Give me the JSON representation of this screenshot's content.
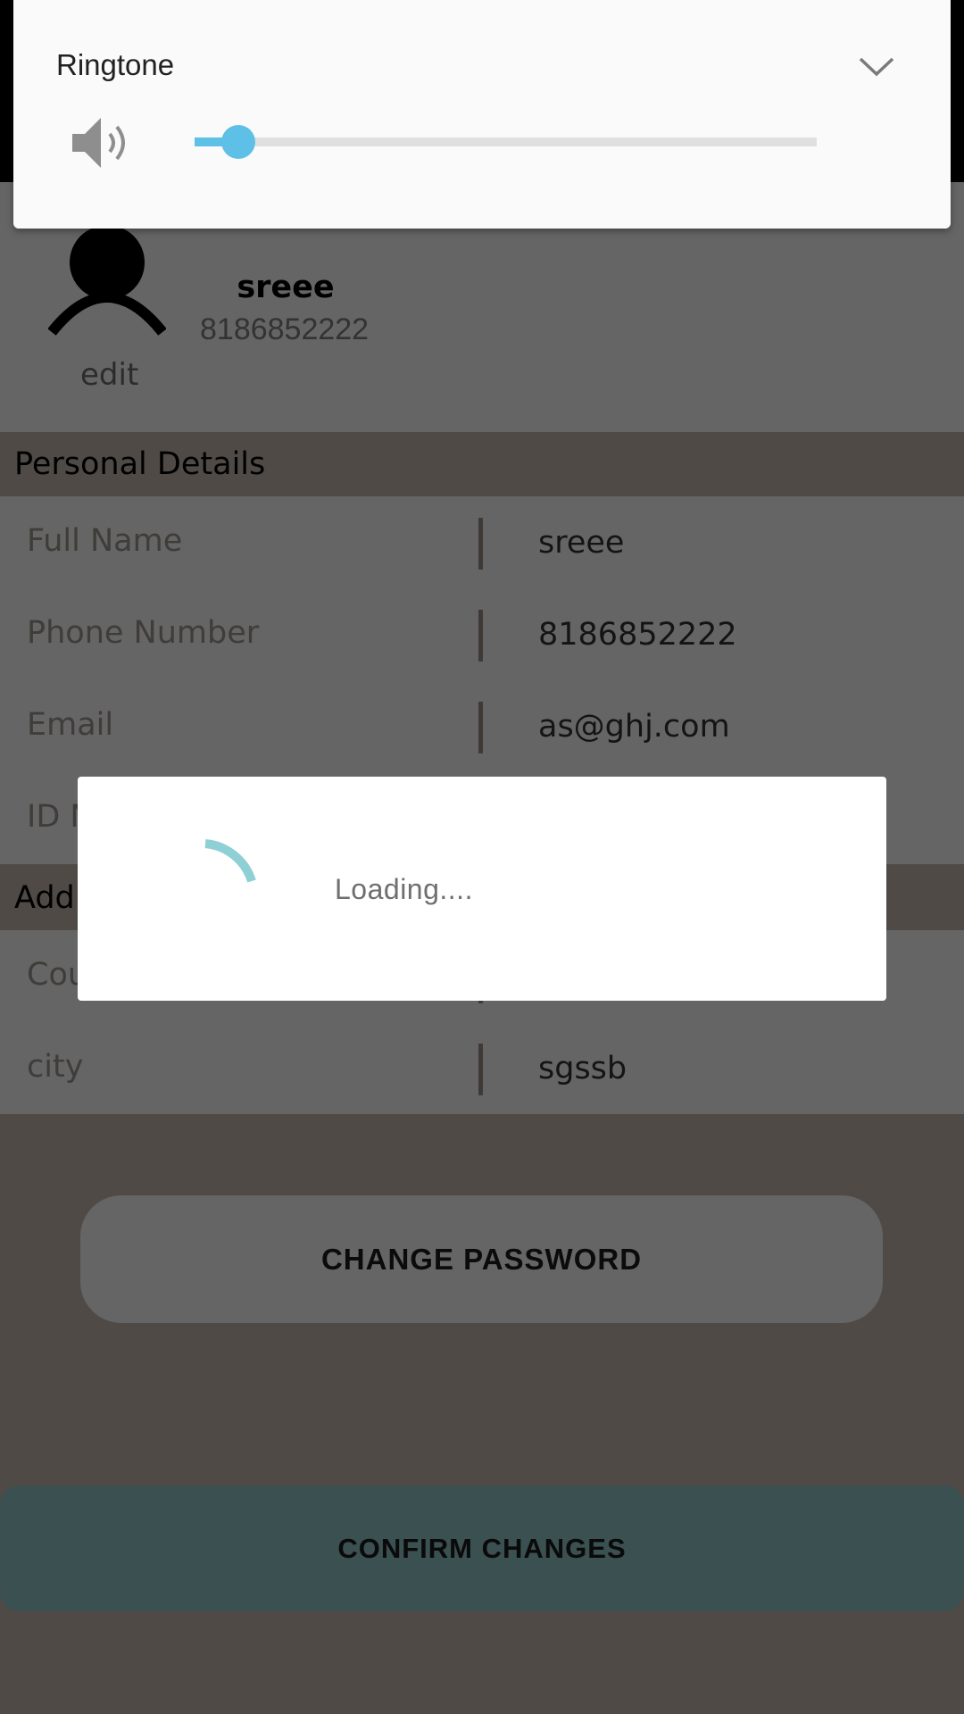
{
  "profile": {
    "name": "sreee",
    "phone": "8186852222",
    "edit_label": "edit"
  },
  "personal_details": {
    "title": "Personal Details",
    "fields": [
      {
        "label": "Full Name",
        "value": "sreee"
      },
      {
        "label": "Phone Number",
        "value": "8186852222"
      },
      {
        "label": "Email",
        "value": "as@ghj.com"
      },
      {
        "label": "ID N",
        "value": ""
      }
    ]
  },
  "address": {
    "title": "Add",
    "fields": [
      {
        "label": "Cou",
        "value": ""
      },
      {
        "label": "city",
        "value": "sgssb"
      }
    ]
  },
  "buttons": {
    "change_password": "CHANGE PASSWORD",
    "confirm_changes": "CONFIRM CHANGES"
  },
  "loading_dialog": {
    "text": "Loading...."
  },
  "volume_panel": {
    "stream": "Ringtone",
    "level": 0.07,
    "accent_color": "#5ec0e6",
    "icons": {
      "speaker": "speaker-icon",
      "expand": "chevron-down-icon"
    }
  }
}
